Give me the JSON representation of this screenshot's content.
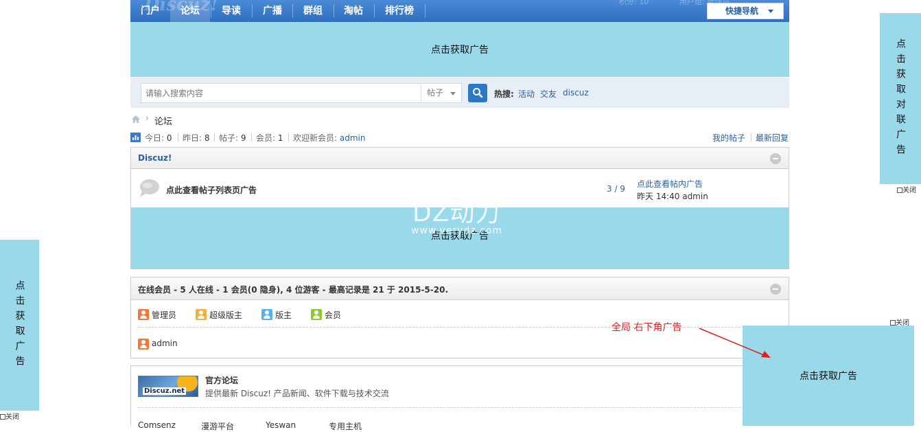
{
  "nav": {
    "items": [
      "门户",
      "论坛",
      "导读",
      "广播",
      "群组",
      "淘帖",
      "排行榜"
    ],
    "ghost_logo": "Discuz!",
    "ghost_points": "积分: 10",
    "ghost_user": "用户组: 管理员",
    "quick_nav": "快捷导航"
  },
  "top_ad": "点击获取广告",
  "search": {
    "placeholder": "请输入搜索内容",
    "type": "帖子",
    "hot_label": "热搜:",
    "hot_links": [
      "活动",
      "交友",
      "discuz"
    ]
  },
  "breadcrumb": {
    "current": "论坛"
  },
  "stats": {
    "today": "今日: ",
    "today_val": "0",
    "yesterday": "昨日: ",
    "yesterday_val": "8",
    "posts": "帖子: ",
    "posts_val": "9",
    "members": "会员: ",
    "members_val": "1",
    "welcome": "欢迎新会员: ",
    "welcome_user": "admin",
    "my_posts": "我的帖子",
    "latest_reply": "最新回复"
  },
  "forum_panel": {
    "title": "Discuz!",
    "forum_name": "点此查看帖子列表页广告",
    "counts": "3 / 9",
    "last_post_title": "点此查看帖内广告",
    "last_post_meta": "昨天 14:40 admin",
    "ad": "点击获取广告",
    "watermark_main": "DZ动力",
    "watermark_sub": "www.verydz.com"
  },
  "online_panel": {
    "title": "在线会员 - 5 人在线 - 1 会员(0 隐身), 4 位游客 - 最高记录是 21 于 2015-5-20.",
    "legend": [
      "管理员",
      "超级版主",
      "版主",
      "会员"
    ],
    "user": "admin"
  },
  "links_panel": {
    "logo_text": "Discuz.net",
    "name": "官方论坛",
    "desc": "提供最新 Discuz! 产品新闻、软件下载与技术交流",
    "bottom_links": [
      "Comsenz",
      "漫游平台",
      "Yeswan",
      "专用主机"
    ]
  },
  "couplet_right": {
    "text": "点击获取对联广告",
    "close": "关闭"
  },
  "couplet_left": {
    "text": "点击获取广告",
    "close": "关闭"
  },
  "corner_ad": {
    "text": "点击获取广告",
    "close": "关闭",
    "annotation": "全局 右下角广告"
  },
  "colors": {
    "nav": "#2f6fbf",
    "ad": "#99d9ea",
    "link": "#2a5f9e",
    "annotation": "#e02020"
  }
}
